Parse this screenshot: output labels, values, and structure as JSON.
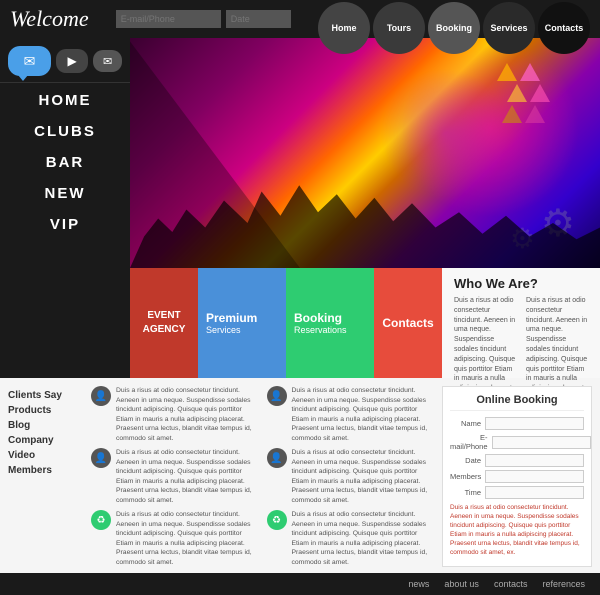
{
  "header": {
    "logo": "Welcome",
    "inputs": {
      "email_placeholder": "E-mail/Phone",
      "date_placeholder": "Date"
    },
    "nav": [
      {
        "label": "Home",
        "key": "home"
      },
      {
        "label": "Tours",
        "key": "tours"
      },
      {
        "label": "Booking",
        "key": "booking"
      },
      {
        "label": "Services",
        "key": "services"
      },
      {
        "label": "Contacts",
        "key": "contacts"
      }
    ]
  },
  "sidenav": {
    "items": [
      {
        "label": "HOME"
      },
      {
        "label": "CLUBS"
      },
      {
        "label": "BAR"
      },
      {
        "label": "NEW"
      },
      {
        "label": "VIP"
      }
    ]
  },
  "middle": {
    "event_agency": "EVENT\nAGENCY",
    "premium": {
      "title": "Premium",
      "sub": "Services"
    },
    "booking_res": {
      "title": "Booking",
      "sub": "Reservations"
    },
    "contacts": "Contacts",
    "who_title": "Who We Are?",
    "who_col1": "Duis a risus at odio consectetur tincidunt. Aeneen in uma neque. Suspendisse sodales tincidunt adipiscing. Quisque quis porttitor Etiam in mauris a nulla adipiscing placerat. Praesent urna lectus, blandit vitae tempus id, commodo sit amet, ex.",
    "who_col2": "Duis a risus at odio consectetur tincidunt. Aeneen in uma neque. Suspendisse sodales tincidunt adipiscing. Quisque quis porttitor Etiam in mauris a nulla adipiscing placerat. Praesent urna lectus, blandit vitae tempus id, commodo sit amet, ex."
  },
  "bottom_left": {
    "links": [
      {
        "label": "Clients Say"
      },
      {
        "label": "Products"
      },
      {
        "label": "Blog"
      },
      {
        "label": "Company"
      },
      {
        "label": "Video"
      },
      {
        "label": "Members"
      }
    ]
  },
  "testimonials": [
    {
      "icon": "👤",
      "text": "Duis a risus at odio consectetur tincidunt. Aeneen in uma neque. Suspendisse sodales tincidunt adipiscing. Quisque quis porttitor Etiam in mauris a nulla adipiscing placerat. Praesent urna lectus, blandit vitae tempus id, commodo sit amet."
    },
    {
      "icon": "👤",
      "text": "Duis a risus at odio consectetur tincidunt. Aeneen in uma neque. Suspendisse sodales tincidunt adipiscing. Quisque quis porttitor Etiam in mauris a nulla adipiscing placerat. Praesent urna lectus, blandit vitae tempus id, commodo sit amet."
    },
    {
      "icon": "♻",
      "text": "Duis a risus at odio consectetur tincidunt. Aeneen in uma neque. Suspendisse sodales tincidunt adipiscing. Quisque quis porttitor Etiam in mauris a nulla adipiscing placerat. Praesent urna lectus, blandit vitae tempus id, commodo sit amet."
    }
  ],
  "testimonials_right": [
    {
      "icon": "👤",
      "text": "Duis a risus at odio consectetur tincidunt. Aeneen in uma neque. Suspendisse sodales tincidunt adipiscing. Quisque quis porttitor Etiam in mauris a nulla adipiscing placerat. Praesent urna lectus, blandit vitae tempus id, commodo sit amet."
    },
    {
      "icon": "👤",
      "text": "Duis a risus at odio consectetur tincidunt. Aeneen in uma neque. Suspendisse sodales tincidunt adipiscing. Quisque quis porttitor Etiam in mauris a nulla adipiscing placerat. Praesent urna lectus, blandit vitae tempus id, commodo sit amet."
    },
    {
      "icon": "♻",
      "text": "Duis a risus at odio consectetur tincidunt. Aeneen in uma neque. Suspendisse sodales tincidunt adipiscing. Quisque quis porttitor Etiam in mauris a nulla adipiscing placerat. Praesent urna lectus, blandit vitae tempus id, commodo sit amet."
    }
  ],
  "online_booking": {
    "title": "Online Booking",
    "fields": [
      {
        "label": "Name"
      },
      {
        "label": "E-mail/Phone"
      },
      {
        "label": "Date"
      },
      {
        "label": "Members"
      },
      {
        "label": "Time"
      }
    ],
    "note": "Duis a risus at odio consectetur tincidunt. Aeneen in uma neque. Suspendisse sodales tincidunt adipiscing. Quisque quis porttitor Etiam in mauris a nulla adipiscing placerat. Praesent urna lectus, blandit vitae tempus id, commodo sit amet, ex."
  },
  "footer": {
    "links": [
      "news",
      "about us",
      "contacts",
      "references"
    ]
  }
}
